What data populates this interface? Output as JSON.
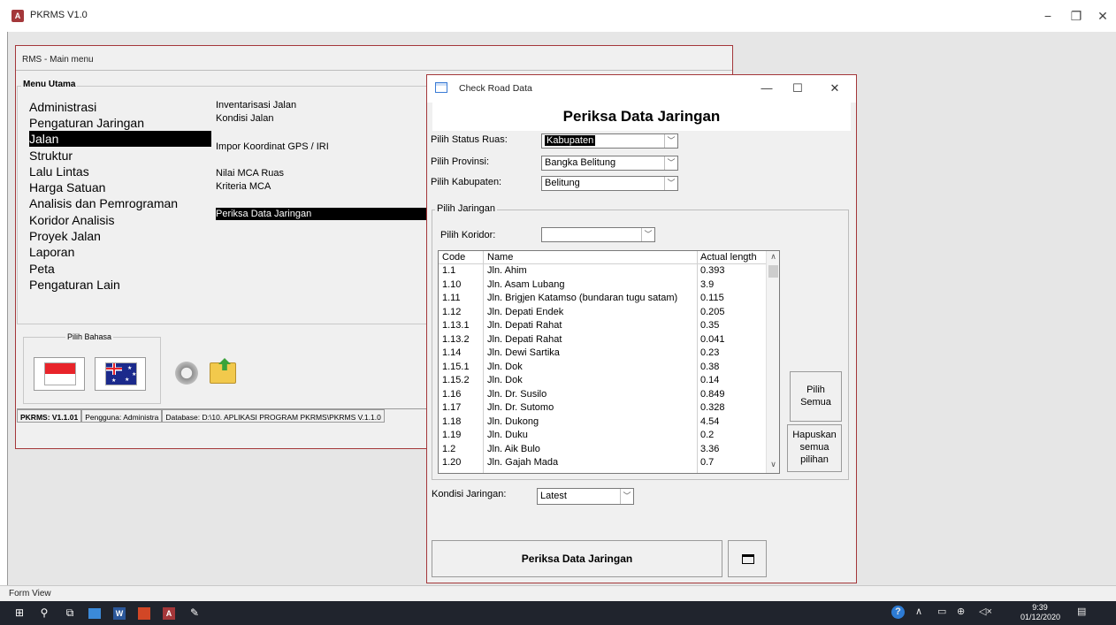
{
  "app": {
    "title": "PKRMS V1.0",
    "logo_letter": "A",
    "controls": {
      "minimize": "−",
      "restore": "❐",
      "close": "✕"
    }
  },
  "main_form": {
    "caption": "RMS - Main menu",
    "group_label": "Menu Utama",
    "menu_items": [
      {
        "label": "Administrasi",
        "active": false
      },
      {
        "label": "Pengaturan Jaringan",
        "active": false
      },
      {
        "label": "Jalan",
        "active": true
      },
      {
        "label": "Struktur",
        "active": false
      },
      {
        "label": "Lalu Lintas",
        "active": false
      },
      {
        "label": "Harga Satuan",
        "active": false
      },
      {
        "label": "Analisis dan Pemrograman",
        "active": false
      },
      {
        "label": "Koridor Analisis",
        "active": false
      },
      {
        "label": "Proyek Jalan",
        "active": false
      },
      {
        "label": "Laporan",
        "active": false
      },
      {
        "label": "Peta",
        "active": false
      },
      {
        "label": "Pengaturan Lain",
        "active": false
      }
    ],
    "sub_items": [
      {
        "label": "Inventarisasi Jalan",
        "active": false
      },
      {
        "label": "Kondisi Jalan",
        "active": false
      },
      {
        "label": "Impor Koordinat GPS / IRI",
        "active": false
      },
      {
        "label": "Nilai MCA Ruas",
        "active": false
      },
      {
        "label": "Kriteria MCA",
        "active": false
      },
      {
        "label": "Periksa Data Jaringan",
        "active": true
      }
    ],
    "language_label": "Pilih Bahasa",
    "status": {
      "version": "PKRMS: V1.1.01",
      "user": "Pengguna: Administra",
      "database": "Database: D:\\10. APLIKASI PROGRAM PKRMS\\PKRMS V.1.1.0"
    }
  },
  "dialog": {
    "title": "Check Road Data",
    "heading": "Periksa Data Jaringan",
    "controls": {
      "minimize": "—",
      "maximize": "☐",
      "close": "✕"
    },
    "status_ruas": {
      "label": "Pilih Status Ruas:",
      "value": "Kabupaten"
    },
    "provinsi": {
      "label": "Pilih Provinsi:",
      "value": "Bangka Belitung"
    },
    "kabupaten": {
      "label": "Pilih Kabupaten:",
      "value": "Belitung"
    },
    "jaringan_group": "Pilih Jaringan",
    "koridor": {
      "label": "Pilih Koridor:",
      "value": ""
    },
    "list": {
      "headers": {
        "code": "Code",
        "name": "Name",
        "length": "Actual length"
      },
      "rows": [
        {
          "code": "1.1",
          "name": "Jln. Ahim",
          "length": "0.393"
        },
        {
          "code": "1.10",
          "name": "Jln. Asam Lubang",
          "length": "3.9"
        },
        {
          "code": "1.11",
          "name": "Jln. Brigjen Katamso (bundaran tugu satam)",
          "length": "0.115"
        },
        {
          "code": "1.12",
          "name": "Jln. Depati Endek",
          "length": "0.205"
        },
        {
          "code": "1.13.1",
          "name": "Jln. Depati Rahat",
          "length": "0.35"
        },
        {
          "code": "1.13.2",
          "name": "Jln. Depati Rahat",
          "length": "0.041"
        },
        {
          "code": "1.14",
          "name": "Jln. Dewi Sartika",
          "length": "0.23"
        },
        {
          "code": "1.15.1",
          "name": "Jln. Dok",
          "length": "0.38"
        },
        {
          "code": "1.15.2",
          "name": "Jln. Dok",
          "length": "0.14"
        },
        {
          "code": "1.16",
          "name": "Jln. Dr. Susilo",
          "length": "0.849"
        },
        {
          "code": "1.17",
          "name": "Jln. Dr. Sutomo",
          "length": "0.328"
        },
        {
          "code": "1.18",
          "name": "Jln. Dukong",
          "length": "4.54"
        },
        {
          "code": "1.19",
          "name": "Jln. Duku",
          "length": "0.2"
        },
        {
          "code": "1.2",
          "name": "Jln. Aik Bulo",
          "length": "3.36"
        },
        {
          "code": "1.20",
          "name": "Jln. Gajah Mada",
          "length": "0.7"
        }
      ]
    },
    "select_all": {
      "line1": "Pilih",
      "line2": "Semua"
    },
    "clear_all": {
      "line1": "Hapuskan",
      "line2": "semua",
      "line3": "pilihan"
    },
    "kondisi": {
      "label": "Kondisi Jaringan:",
      "value": "Latest"
    },
    "run_button": "Periksa Data Jaringan"
  },
  "status_bar": {
    "text": "Form View"
  },
  "taskbar": {
    "time": "9:39",
    "date": "01/12/2020"
  }
}
